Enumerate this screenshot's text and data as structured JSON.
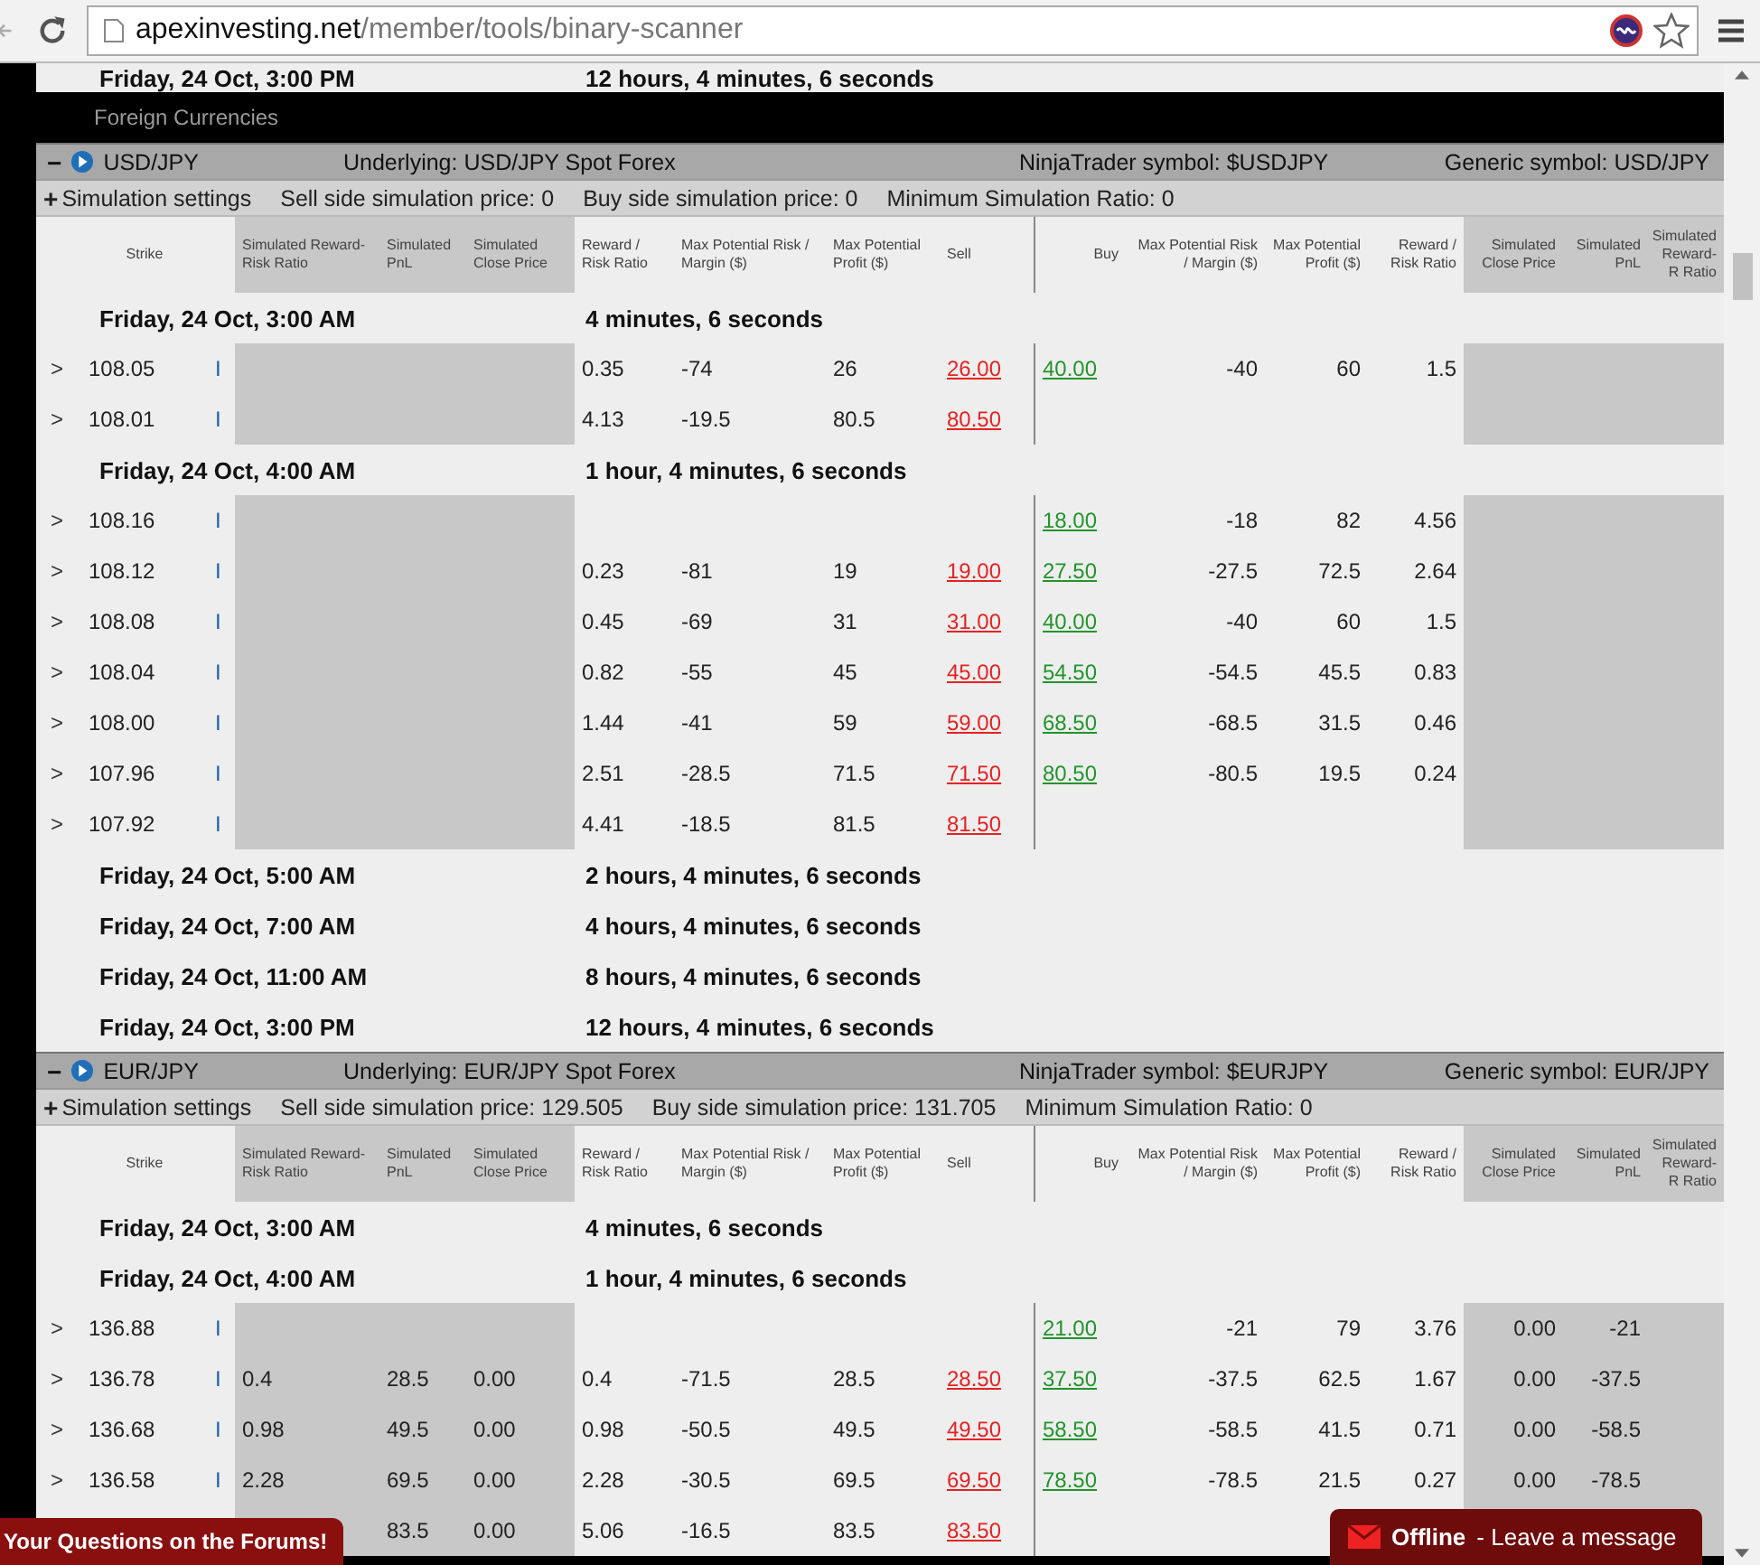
{
  "browser": {
    "url_host": "apexinvesting.net",
    "url_path": "/member/tools/binary-scanner"
  },
  "top_row": {
    "date": "Friday, 24 Oct, 3:00 PM",
    "countdown": "12 hours, 4 minutes, 6 seconds"
  },
  "category": "Foreign Currencies",
  "sections": [
    {
      "collapse": "−",
      "pair": "USD/JPY",
      "underlying": "Underlying: USD/JPY Spot Forex",
      "ninja": "NinjaTrader symbol: $USDJPY",
      "generic": "Generic symbol: USD/JPY",
      "settings_toggle": "+",
      "settings_label": "Simulation settings",
      "sell_sim": "Sell side simulation price: 0",
      "buy_sim": "Buy side simulation price: 0",
      "min_ratio": "Minimum Simulation Ratio: 0",
      "columns": [
        "Strike",
        "Simulated Reward-Risk Ratio",
        "Simulated PnL",
        "Simulated Close Price",
        "Reward / Risk Ratio",
        "Max Potential Risk / Margin ($)",
        "Max Potential Profit ($)",
        "Sell",
        "Buy",
        "Max Potential Risk / Margin ($)",
        "Max Potential Profit ($)",
        "Reward / Risk Ratio",
        "Simulated Close Price",
        "Simulated PnL",
        "Simulated Reward-R Ratio"
      ],
      "groups": [
        {
          "date": "Friday, 24 Oct, 3:00 AM",
          "countdown": "4 minutes, 6 seconds",
          "rows": [
            {
              "caret": ">",
              "strike": "108.05",
              "marker": "I",
              "rr": "0.35",
              "max_risk": "-74",
              "max_profit": "26",
              "sell": "26.00",
              "buy": "40.00",
              "max_risk_buy": "-40",
              "max_profit_buy": "60",
              "rr_buy": "1.5"
            },
            {
              "caret": ">",
              "strike": "108.01",
              "marker": "I",
              "rr": "4.13",
              "max_risk": "-19.5",
              "max_profit": "80.5",
              "sell": "80.50"
            }
          ]
        },
        {
          "date": "Friday, 24 Oct, 4:00 AM",
          "countdown": "1 hour, 4 minutes, 6 seconds",
          "rows": [
            {
              "caret": ">",
              "strike": "108.16",
              "marker": "I",
              "buy": "18.00",
              "max_risk_buy": "-18",
              "max_profit_buy": "82",
              "rr_buy": "4.56"
            },
            {
              "caret": ">",
              "strike": "108.12",
              "marker": "I",
              "rr": "0.23",
              "max_risk": "-81",
              "max_profit": "19",
              "sell": "19.00",
              "buy": "27.50",
              "max_risk_buy": "-27.5",
              "max_profit_buy": "72.5",
              "rr_buy": "2.64"
            },
            {
              "caret": ">",
              "strike": "108.08",
              "marker": "I",
              "rr": "0.45",
              "max_risk": "-69",
              "max_profit": "31",
              "sell": "31.00",
              "buy": "40.00",
              "max_risk_buy": "-40",
              "max_profit_buy": "60",
              "rr_buy": "1.5"
            },
            {
              "caret": ">",
              "strike": "108.04",
              "marker": "I",
              "rr": "0.82",
              "max_risk": "-55",
              "max_profit": "45",
              "sell": "45.00",
              "buy": "54.50",
              "max_risk_buy": "-54.5",
              "max_profit_buy": "45.5",
              "rr_buy": "0.83"
            },
            {
              "caret": ">",
              "strike": "108.00",
              "marker": "I",
              "rr": "1.44",
              "max_risk": "-41",
              "max_profit": "59",
              "sell": "59.00",
              "buy": "68.50",
              "max_risk_buy": "-68.5",
              "max_profit_buy": "31.5",
              "rr_buy": "0.46"
            },
            {
              "caret": ">",
              "strike": "107.96",
              "marker": "I",
              "rr": "2.51",
              "max_risk": "-28.5",
              "max_profit": "71.5",
              "sell": "71.50",
              "buy": "80.50",
              "max_risk_buy": "-80.5",
              "max_profit_buy": "19.5",
              "rr_buy": "0.24"
            },
            {
              "caret": ">",
              "strike": "107.92",
              "marker": "I",
              "rr": "4.41",
              "max_risk": "-18.5",
              "max_profit": "81.5",
              "sell": "81.50"
            }
          ]
        },
        {
          "date": "Friday, 24 Oct, 5:00 AM",
          "countdown": "2 hours, 4 minutes, 6 seconds"
        },
        {
          "date": "Friday, 24 Oct, 7:00 AM",
          "countdown": "4 hours, 4 minutes, 6 seconds"
        },
        {
          "date": "Friday, 24 Oct, 11:00 AM",
          "countdown": "8 hours, 4 minutes, 6 seconds"
        },
        {
          "date": "Friday, 24 Oct, 3:00 PM",
          "countdown": "12 hours, 4 minutes, 6 seconds"
        }
      ]
    },
    {
      "collapse": "−",
      "pair": "EUR/JPY",
      "underlying": "Underlying: EUR/JPY Spot Forex",
      "ninja": "NinjaTrader symbol: $EURJPY",
      "generic": "Generic symbol: EUR/JPY",
      "settings_toggle": "+",
      "settings_label": "Simulation settings",
      "sell_sim": "Sell side simulation price: 129.505",
      "buy_sim": "Buy side simulation price: 131.705",
      "min_ratio": "Minimum Simulation Ratio: 0",
      "columns": [
        "Strike",
        "Simulated Reward-Risk Ratio",
        "Simulated PnL",
        "Simulated Close Price",
        "Reward / Risk Ratio",
        "Max Potential Risk / Margin ($)",
        "Max Potential Profit ($)",
        "Sell",
        "Buy",
        "Max Potential Risk / Margin ($)",
        "Max Potential Profit ($)",
        "Reward / Risk Ratio",
        "Simulated Close Price",
        "Simulated PnL",
        "Simulated Reward-R Ratio"
      ],
      "groups": [
        {
          "date": "Friday, 24 Oct, 3:00 AM",
          "countdown": "4 minutes, 6 seconds"
        },
        {
          "date": "Friday, 24 Oct, 4:00 AM",
          "countdown": "1 hour, 4 minutes, 6 seconds",
          "rows": [
            {
              "caret": ">",
              "strike": "136.88",
              "marker": "I",
              "buy": "21.00",
              "max_risk_buy": "-21",
              "max_profit_buy": "79",
              "rr_buy": "3.76",
              "sim_close_buy": "0.00",
              "sim_pnl_buy": "-21"
            },
            {
              "caret": ">",
              "strike": "136.78",
              "marker": "I",
              "sim_rr": "0.4",
              "sim_pnl": "28.5",
              "sim_close": "0.00",
              "rr": "0.4",
              "max_risk": "-71.5",
              "max_profit": "28.5",
              "sell": "28.50",
              "buy": "37.50",
              "max_risk_buy": "-37.5",
              "max_profit_buy": "62.5",
              "rr_buy": "1.67",
              "sim_close_buy": "0.00",
              "sim_pnl_buy": "-37.5"
            },
            {
              "caret": ">",
              "strike": "136.68",
              "marker": "I",
              "sim_rr": "0.98",
              "sim_pnl": "49.5",
              "sim_close": "0.00",
              "rr": "0.98",
              "max_risk": "-50.5",
              "max_profit": "49.5",
              "sell": "49.50",
              "buy": "58.50",
              "max_risk_buy": "-58.5",
              "max_profit_buy": "41.5",
              "rr_buy": "0.71",
              "sim_close_buy": "0.00",
              "sim_pnl_buy": "-58.5"
            },
            {
              "caret": ">",
              "strike": "136.58",
              "marker": "I",
              "sim_rr": "2.28",
              "sim_pnl": "69.5",
              "sim_close": "0.00",
              "rr": "2.28",
              "max_risk": "-30.5",
              "max_profit": "69.5",
              "sell": "69.50",
              "buy": "78.50",
              "max_risk_buy": "-78.5",
              "max_profit_buy": "21.5",
              "rr_buy": "0.27",
              "sim_close_buy": "0.00",
              "sim_pnl_buy": "-78.5"
            },
            {
              "sim_pnl": "83.5",
              "sim_close": "0.00",
              "rr": "5.06",
              "max_risk": "-16.5",
              "max_profit": "83.5",
              "sell": "83.50"
            }
          ]
        }
      ]
    }
  ],
  "forum_banner": "Your Questions on the Forums!",
  "chat": {
    "status": "Offline",
    "message": "- Leave a message"
  }
}
